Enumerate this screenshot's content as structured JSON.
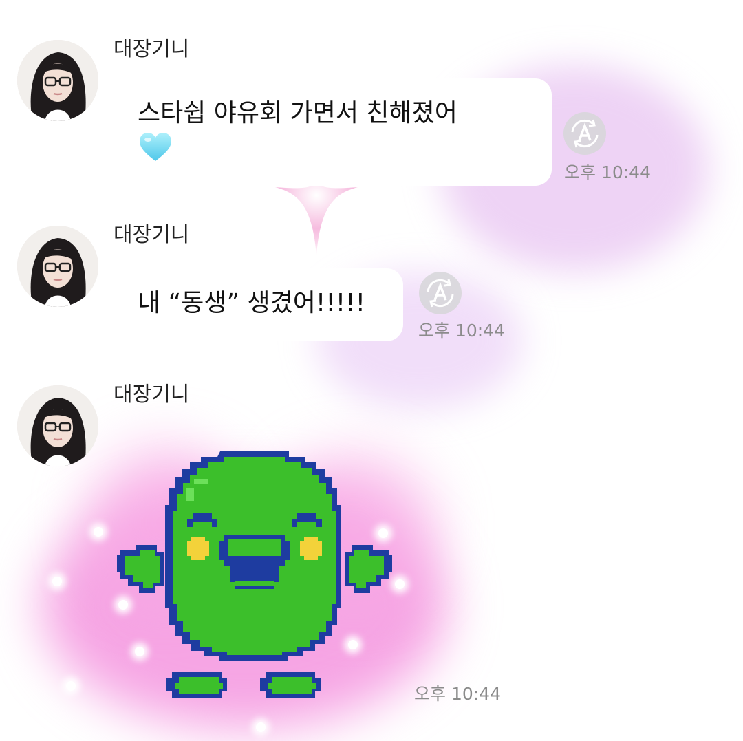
{
  "conversation": {
    "messages": [
      {
        "sender": "대장기니",
        "text": "스타쉽 야유회 가면서 친해졌어",
        "emoji": "light-blue-heart",
        "time": "오후 10:44"
      },
      {
        "sender": "대장기니",
        "text": "내 “동생” 생겼어!!!!!",
        "time": "오후 10:44"
      },
      {
        "sender": "대장기니",
        "sticker": "green-pixel-creature-sticker",
        "time": "오후 10:44"
      }
    ]
  },
  "icons": {
    "auto_translate": "auto-translate-icon",
    "heart": "light-blue-heart-icon",
    "avatar": "profile-photo"
  },
  "colors": {
    "bubble_background": "#ffffff",
    "timestamp_text": "#8b8b8b",
    "background_glow_pink": "#f48cdc",
    "background_glow_lilac": "#dea8eb",
    "sticker_green": "#3cbf2b",
    "sticker_outline": "#1e3ca0",
    "sticker_cheek": "#f3d23a",
    "heart_blue": "#7fe0f4"
  }
}
